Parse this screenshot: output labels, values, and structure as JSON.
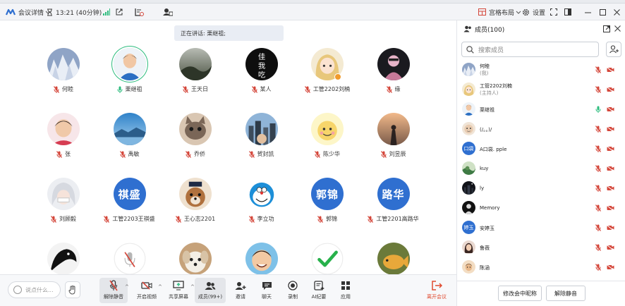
{
  "title_bar": {
    "meeting_details": "会议详情",
    "duration": "13:21 (40分钟)",
    "layout_label": "宫格布局",
    "settings_label": "设置"
  },
  "speaking": "正在讲话: 栗继祖;",
  "participants": [
    {
      "name": "何睦",
      "avatar": "snowy-trees"
    },
    {
      "name": "栗继祖",
      "avatar": "boy-photo",
      "speaking": true
    },
    {
      "name": "王天日",
      "avatar": "dark-landscape"
    },
    {
      "name": "某人",
      "avatar": "black-calligraphy",
      "avatar_text": "佳\n我\n吃"
    },
    {
      "name": "工管2202刘楠",
      "avatar": "anime-girl",
      "host": true
    },
    {
      "name": "缘",
      "avatar": "pink-figure"
    },
    {
      "name": "张",
      "avatar": "child-photo"
    },
    {
      "name": "禹敏",
      "avatar": "blue-sky-lake"
    },
    {
      "name": "乔侨",
      "avatar": "cat-face"
    },
    {
      "name": "贺封凯",
      "avatar": "city-photo"
    },
    {
      "name": "陈少华",
      "avatar": "yellow-cartoon"
    },
    {
      "name": "刘昱辰",
      "avatar": "sunset-figure"
    },
    {
      "name": "刘顾毅",
      "avatar": "anime-white-hair"
    },
    {
      "name": "工管2203王祺盛",
      "avatar_text": "祺盛"
    },
    {
      "name": "王心志2201",
      "avatar": "dog-portrait"
    },
    {
      "name": "李立功",
      "avatar": "doraemon"
    },
    {
      "name": "郭锦",
      "avatar_text": "郭锦"
    },
    {
      "name": "工管2201高路华",
      "avatar_text": "路华"
    },
    {
      "name": "",
      "avatar": "dark-bird"
    },
    {
      "name": "",
      "avatar": "small-mic"
    },
    {
      "name": "",
      "avatar": "white-dog"
    },
    {
      "name": "",
      "avatar": "smiling-kid"
    },
    {
      "name": "",
      "avatar": "green-check"
    },
    {
      "name": "",
      "avatar": "goldfish"
    }
  ],
  "toolbar": {
    "chat_placeholder": "说点什么...",
    "unmute": "解除静音",
    "start_video": "开启视频",
    "share_screen": "共享屏幕",
    "members": "成员(99+)",
    "invite": "邀请",
    "chat": "聊天",
    "record": "录制",
    "ai_minutes": "AI纪要",
    "apps": "应用",
    "leave": "离开会议"
  },
  "panel": {
    "title": "成员(100)",
    "search_placeholder": "搜索成员",
    "members": [
      {
        "name": "何睦",
        "sub": "(我)",
        "avatar": "snowy-trees"
      },
      {
        "name": "工管2202刘楠",
        "sub": "(主持人)",
        "avatar": "anime-girl"
      },
      {
        "name": "栗继祖",
        "avatar": "boy-photo",
        "speaking": true
      },
      {
        "name": "(/。。)/",
        "avatar": "cartoon-face"
      },
      {
        "name": "A口袋. pple",
        "avatar_text": "口袋"
      },
      {
        "name": "kuy",
        "avatar": "green-landscape"
      },
      {
        "name": "ly",
        "avatar": "dark-city"
      },
      {
        "name": "Memory",
        "avatar": "dark-portrait"
      },
      {
        "name": "安婷玉",
        "avatar_text": "婷玉"
      },
      {
        "name": "鲁薇",
        "avatar": "girl-portrait"
      },
      {
        "name": "陈涵",
        "avatar": "boy-portrait"
      }
    ],
    "rename_button": "修改会中昵称",
    "unmute_button": "解除静音"
  },
  "colors": {
    "accent": "#2f6fd0",
    "mute_red": "#d4463a",
    "speaking_green": "#2dbc7e",
    "leave_red": "#e04a2f"
  }
}
